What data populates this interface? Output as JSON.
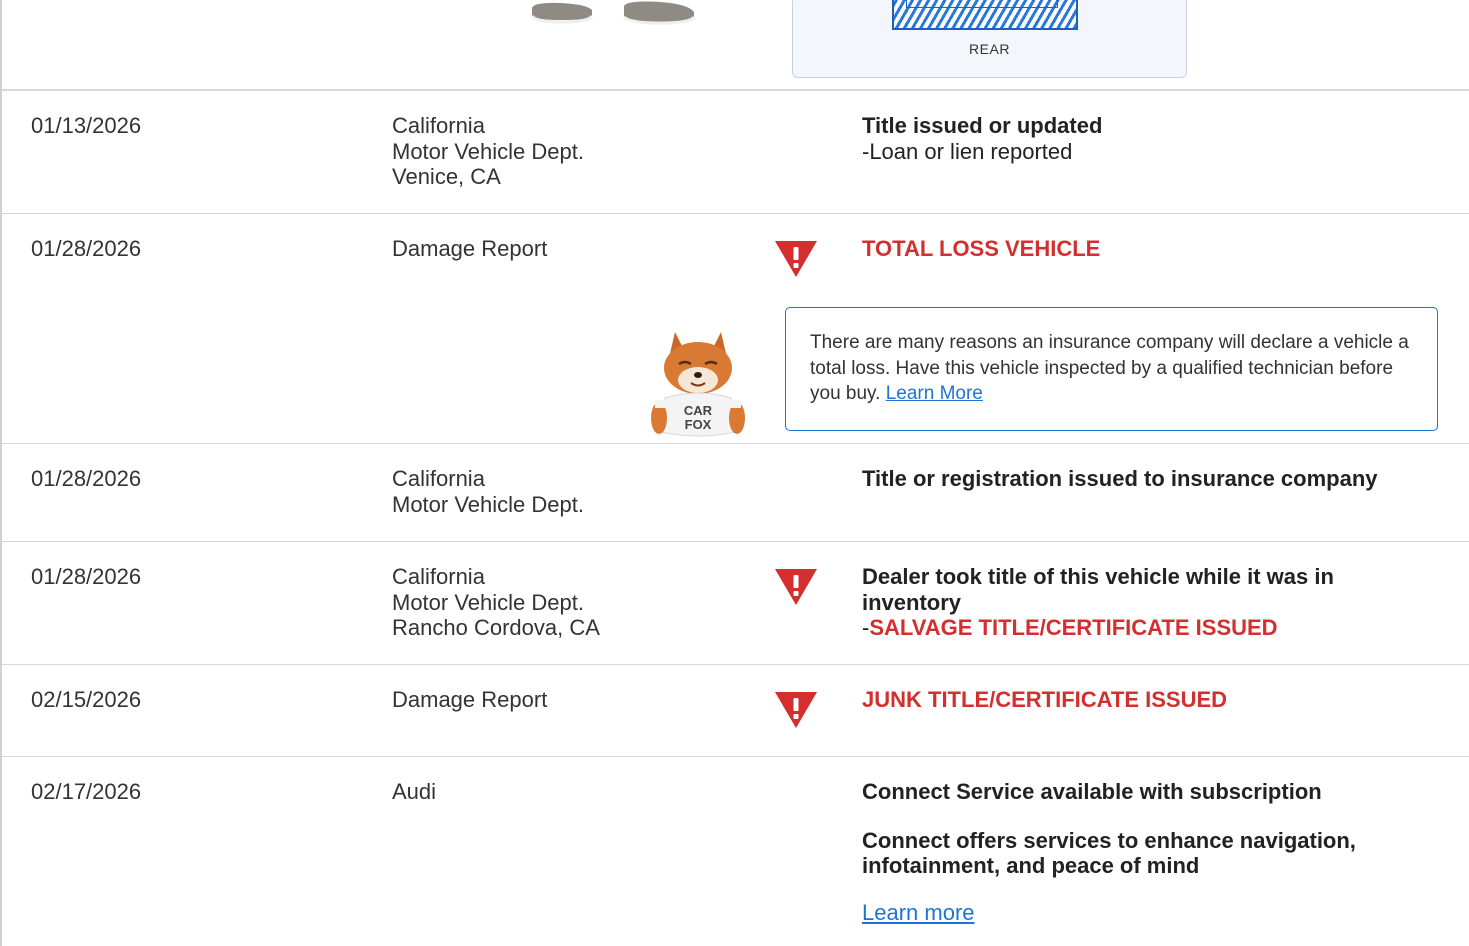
{
  "top_section": {
    "diagram_label": "REAR"
  },
  "records": [
    {
      "date": "01/13/2026",
      "source": [
        "California",
        "Motor Vehicle Dept.",
        "Venice, CA"
      ],
      "comment_title": "Title issued or updated",
      "comment_detail": "-Loan or lien reported"
    },
    {
      "date": "01/28/2026",
      "source": [
        "Damage Report"
      ],
      "comment_alert": "TOTAL LOSS VEHICLE",
      "callout": {
        "text": "There are many reasons an insurance company will declare a vehicle a total loss. Have this vehicle inspected by a qualified technician before you buy.",
        "link": "Learn More",
        "mascot_shirt": [
          "CAR",
          "FOX"
        ]
      }
    },
    {
      "date": "01/28/2026",
      "source": [
        "California",
        "Motor Vehicle Dept."
      ],
      "comment_title": "Title or registration issued to insurance company"
    },
    {
      "date": "01/28/2026",
      "source": [
        "California",
        "Motor Vehicle Dept.",
        "Rancho Cordova, CA"
      ],
      "comment_title": "Dealer took title of this vehicle while it was in inventory",
      "comment_prefix": "-",
      "comment_alert": "SALVAGE TITLE/CERTIFICATE ISSUED"
    },
    {
      "date": "02/15/2026",
      "source": [
        "Damage Report"
      ],
      "comment_alert": "JUNK TITLE/CERTIFICATE ISSUED"
    },
    {
      "date": "02/17/2026",
      "source": [
        "Audi"
      ],
      "comment_title": "Connect Service available with subscription",
      "comment_title_2": "Connect offers services to enhance navigation, infotainment, and peace of mind",
      "link": "Learn more"
    }
  ],
  "colors": {
    "alert_red": "#d32f2f",
    "link_blue": "#1e73d8",
    "divider": "#d8d8d8"
  },
  "icons": {
    "warning": "warning-triangle-icon",
    "mascot": "carfox-mascot-icon"
  }
}
